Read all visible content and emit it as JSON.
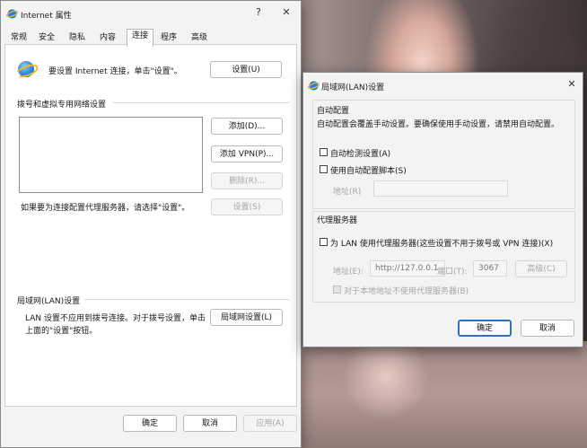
{
  "inet": {
    "title": "Internet 属性",
    "help": "?",
    "close": "✕",
    "tabs": [
      "常规",
      "安全",
      "隐私",
      "内容",
      "连接",
      "程序",
      "高级"
    ],
    "active_tab": "连接",
    "setup_text": "要设置 Internet 连接，单击\"设置\"。",
    "setup_button": "设置(U)",
    "dialup_heading": "拨号和虚拟专用网络设置",
    "add_button": "添加(D)...",
    "add_vpn_button": "添加 VPN(P)...",
    "remove_button": "删除(R)...",
    "proxy_hint": "如果要为连接配置代理服务器，请选择\"设置\"。",
    "settings_button": "设置(S)",
    "lan_heading": "局域网(LAN)设置",
    "lan_desc_line1": "LAN 设置不应用到拨号连接。对于拨号设置，单击",
    "lan_desc_line2": "上面的\"设置\"按钮。",
    "lan_button": "局域网设置(L)",
    "ok": "确定",
    "cancel": "取消",
    "apply": "应用(A)"
  },
  "lan": {
    "title": "局域网(LAN)设置",
    "close": "✕",
    "auto_heading": "自动配置",
    "auto_desc": "自动配置会覆盖手动设置。要确保使用手动设置，请禁用自动配置。",
    "auto_detect": "自动检测设置(A)",
    "auto_script": "使用自动配置脚本(S)",
    "address_label": "地址(R)",
    "proxy_heading": "代理服务器",
    "use_proxy": "为 LAN 使用代理服务器(这些设置不用于拨号或 VPN 连接)(X)",
    "proxy_address_label": "地址(E):",
    "proxy_address": "http://127.0.0.1",
    "port_label": "端口(T):",
    "port": "3067",
    "advanced_button": "高级(C)",
    "bypass_local": "对于本地地址不使用代理服务器(B)",
    "ok": "确定",
    "cancel": "取消"
  }
}
